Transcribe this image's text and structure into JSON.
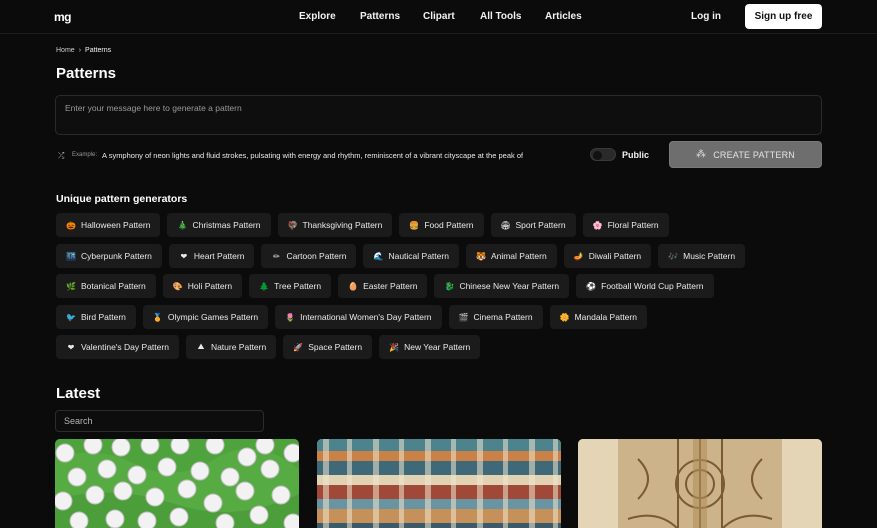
{
  "header": {
    "logo": "mg",
    "nav": [
      "Explore",
      "Patterns",
      "Clipart",
      "All Tools",
      "Articles"
    ],
    "login": "Log in",
    "signup": "Sign up free"
  },
  "breadcrumb": {
    "home": "Home",
    "current": "Patterns"
  },
  "page_title": "Patterns",
  "prompt": {
    "placeholder": "Enter your message here to generate a pattern"
  },
  "example": {
    "label": "Example:",
    "text": "A symphony of neon lights and fluid strokes, pulsating with energy and rhythm, reminiscent of a vibrant cityscape at the peak of"
  },
  "public_label": "Public",
  "create_button": "CREATE PATTERN",
  "generators_title": "Unique pattern generators",
  "generator_rows": [
    [
      {
        "emoji": "🎃",
        "label": "Halloween Pattern"
      },
      {
        "emoji": "🎄",
        "label": "Christmas Pattern"
      },
      {
        "emoji": "🦃",
        "label": "Thanksgiving Pattern"
      },
      {
        "emoji": "🍔",
        "label": "Food Pattern"
      },
      {
        "emoji": "🏟",
        "label": "Sport Pattern"
      },
      {
        "emoji": "🌸",
        "label": "Floral Pattern"
      }
    ],
    [
      {
        "emoji": "🌃",
        "label": "Cyberpunk Pattern"
      },
      {
        "emoji": "❤",
        "label": "Heart Pattern"
      },
      {
        "emoji": "✏",
        "label": "Cartoon Pattern"
      },
      {
        "emoji": "🌊",
        "label": "Nautical Pattern"
      },
      {
        "emoji": "🐯",
        "label": "Animal Pattern"
      },
      {
        "emoji": "🪔",
        "label": "Diwali Pattern"
      },
      {
        "emoji": "🎶",
        "label": "Music Pattern"
      }
    ],
    [
      {
        "emoji": "🌿",
        "label": "Botanical Pattern"
      },
      {
        "emoji": "🎨",
        "label": "Holi Pattern"
      },
      {
        "emoji": "🌲",
        "label": "Tree Pattern"
      },
      {
        "emoji": "🥚",
        "label": "Easter Pattern"
      },
      {
        "emoji": "🐉",
        "label": "Chinese New Year Pattern"
      },
      {
        "emoji": "⚽",
        "label": "Football World Cup Pattern"
      }
    ],
    [
      {
        "emoji": "🐦",
        "label": "Bird Pattern"
      },
      {
        "emoji": "🏅",
        "label": "Olympic Games Pattern"
      },
      {
        "emoji": "🌷",
        "label": "International Women's Day Pattern"
      },
      {
        "emoji": "🎬",
        "label": "Cinema Pattern"
      },
      {
        "emoji": "🌼",
        "label": "Mandala Pattern"
      }
    ],
    [
      {
        "emoji": "❤",
        "label": "Valentine's Day Pattern"
      },
      {
        "emoji": "⛰",
        "label": "Nature Pattern"
      },
      {
        "emoji": "🚀",
        "label": "Space Pattern"
      },
      {
        "emoji": "🎉",
        "label": "New Year Pattern"
      }
    ]
  ],
  "latest_title": "Latest",
  "search": {
    "placeholder": "Search"
  },
  "colors": {
    "background": "#0b0b0b",
    "chip": "#1b1b1b",
    "create_button": "#6e6e6e"
  }
}
